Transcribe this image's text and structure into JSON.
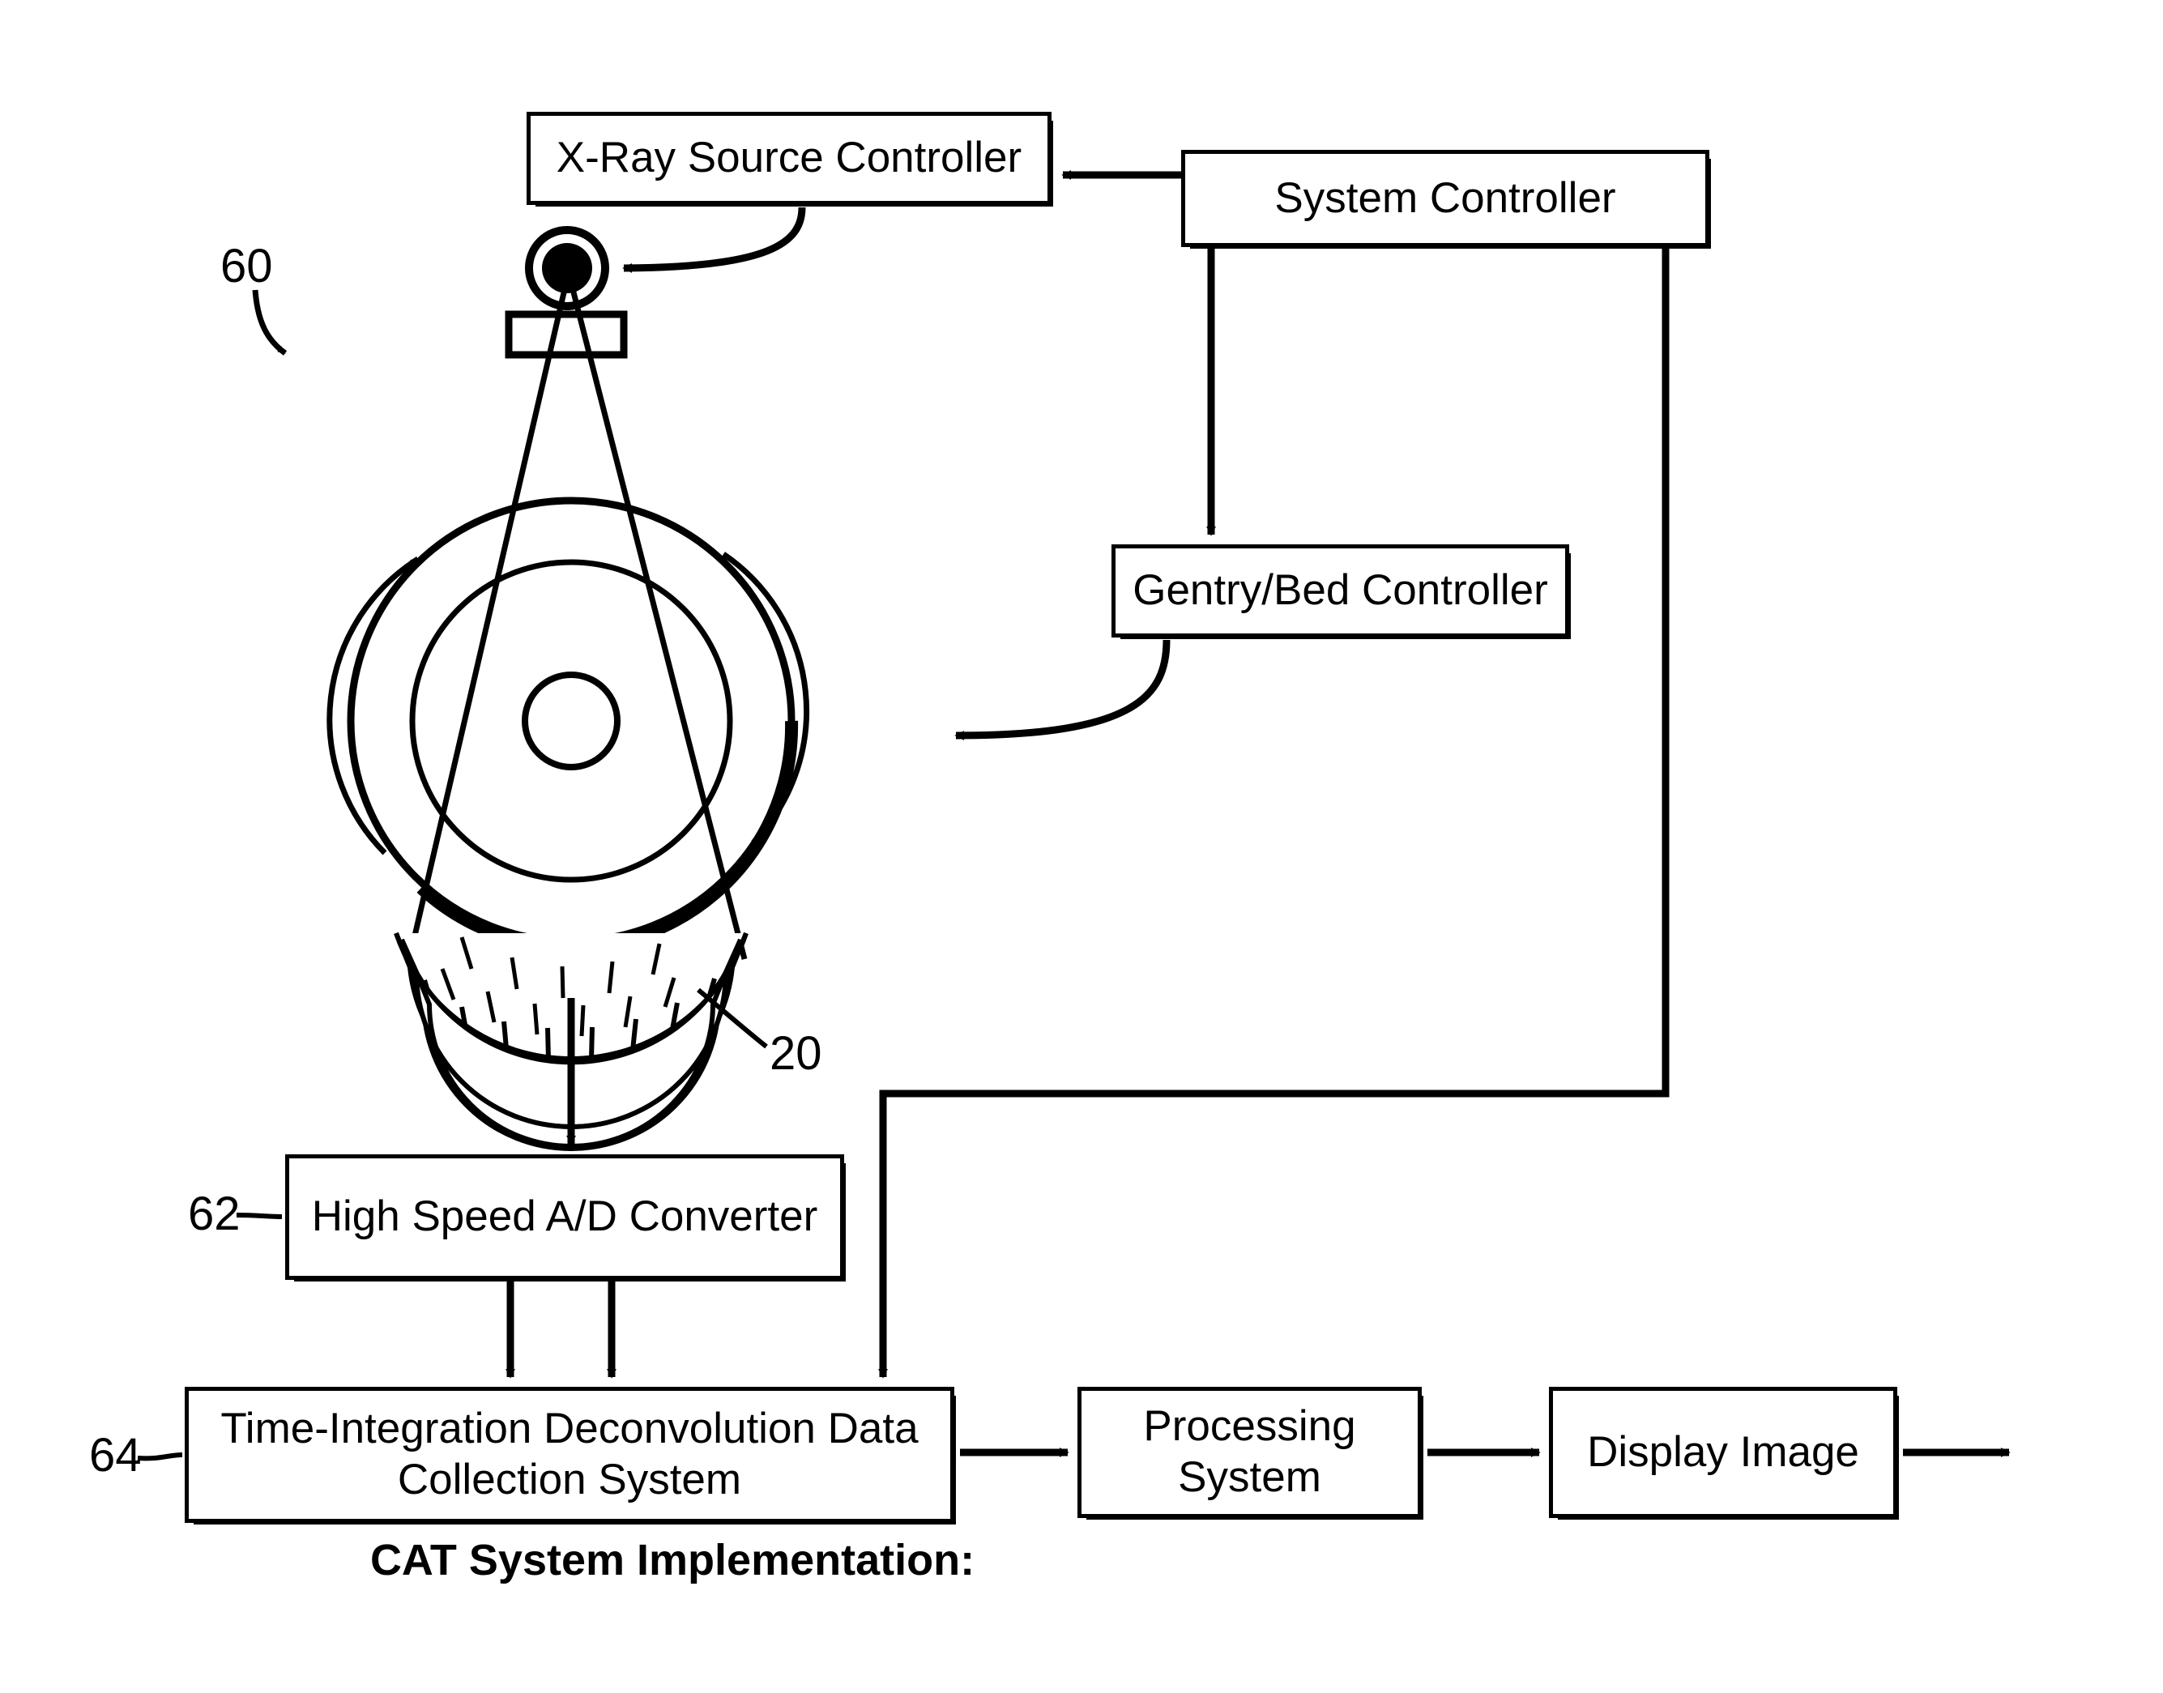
{
  "figure": {
    "caption": "CAT System Implementation:",
    "reference_numerals": {
      "gantry": "60",
      "detector_array": "20",
      "ad_converter": "62",
      "data_collection_system": "64"
    }
  },
  "blocks": {
    "xray_source_controller": "X-Ray Source Controller",
    "system_controller": "System Controller",
    "gentry_bed_controller": "Gentry/Bed Controller",
    "ad_converter": "High Speed A/D Converter",
    "data_collection_system": "Time-Integration Deconvolution Data\nCollection System",
    "processing_system": "Processing\nSystem",
    "display_image": "Display Image"
  },
  "colors": {
    "stroke": "#000000",
    "background": "#ffffff",
    "fill": "#ffffff"
  },
  "graphics": {
    "gantry_outer_ring": "outer-gantry-circle",
    "gantry_inner_ring": "inner-gantry-circle",
    "bore_circle": "patient-bore-circle",
    "xray_tube": "x-ray-tube-source",
    "collimator": "collimator-block",
    "fan_beam": "x-ray-fan-beam",
    "detector_array": "curved-detector-array",
    "rotation_arrow_left": "counterclockwise-rotation-arrow",
    "rotation_arrow_right": "clockwise-rotation-arrow"
  }
}
